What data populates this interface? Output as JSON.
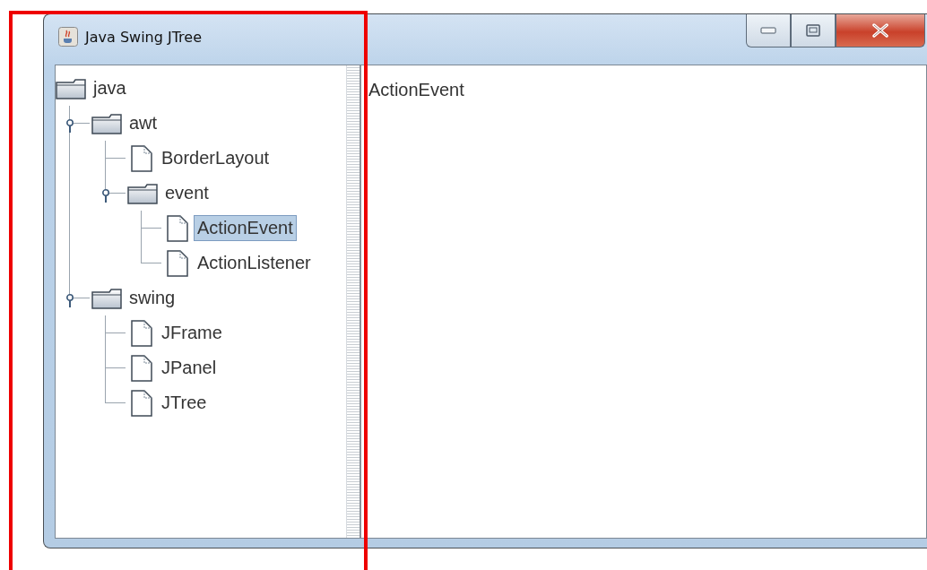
{
  "window": {
    "title": "Java Swing JTree"
  },
  "tree": [
    {
      "label": "java",
      "kind": "folder",
      "selected": false,
      "children": [
        {
          "label": "awt",
          "kind": "folder",
          "expanded": true,
          "selected": false,
          "children": [
            {
              "label": "BorderLayout",
              "kind": "file",
              "selected": false
            },
            {
              "label": "event",
              "kind": "folder",
              "expanded": true,
              "selected": false,
              "children": [
                {
                  "label": "ActionEvent",
                  "kind": "file",
                  "selected": true
                },
                {
                  "label": "ActionListener",
                  "kind": "file",
                  "selected": false
                }
              ]
            }
          ]
        },
        {
          "label": "swing",
          "kind": "folder",
          "expanded": true,
          "selected": false,
          "children": [
            {
              "label": "JFrame",
              "kind": "file",
              "selected": false
            },
            {
              "label": "JPanel",
              "kind": "file",
              "selected": false
            },
            {
              "label": "JTree",
              "kind": "file",
              "selected": false
            }
          ]
        }
      ]
    }
  ],
  "detail": {
    "text": "ActionEvent"
  }
}
